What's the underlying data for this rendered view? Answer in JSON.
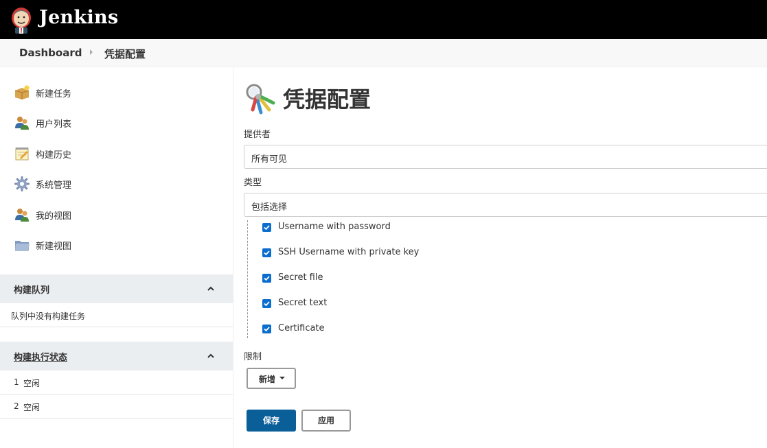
{
  "app": {
    "name": "Jenkins"
  },
  "breadcrumb": {
    "root": "Dashboard",
    "current": "凭据配置"
  },
  "sidebar": {
    "tasks": [
      {
        "label": "新建任务",
        "icon": "new-package-icon"
      },
      {
        "label": "用户列表",
        "icon": "users-icon"
      },
      {
        "label": "构建历史",
        "icon": "notepad-icon"
      },
      {
        "label": "系统管理",
        "icon": "gear-icon"
      },
      {
        "label": "我的视图",
        "icon": "users-icon"
      },
      {
        "label": "新建视图",
        "icon": "folder-icon"
      }
    ],
    "build_queue": {
      "title": "构建队列",
      "empty_text": "队列中没有构建任务"
    },
    "executors": {
      "title": "构建执行状态",
      "rows": [
        {
          "index": "1",
          "status": "空闲"
        },
        {
          "index": "2",
          "status": "空闲"
        }
      ]
    }
  },
  "main": {
    "title": "凭据配置",
    "providers_label": "提供者",
    "providers_value": "所有可见",
    "types_label": "类型",
    "types_value": "包括选择",
    "types_options": [
      {
        "label": "Username with password",
        "checked": true
      },
      {
        "label": "SSH Username with private key",
        "checked": true
      },
      {
        "label": "Secret file",
        "checked": true
      },
      {
        "label": "Secret text",
        "checked": true
      },
      {
        "label": "Certificate",
        "checked": true
      }
    ],
    "restrictions_label": "限制",
    "add_button": "新增",
    "save_button": "保存",
    "apply_button": "应用"
  },
  "colors": {
    "header_bg": "#000000",
    "accent": "#0b6ecf",
    "save_bg": "#0b5f99"
  }
}
